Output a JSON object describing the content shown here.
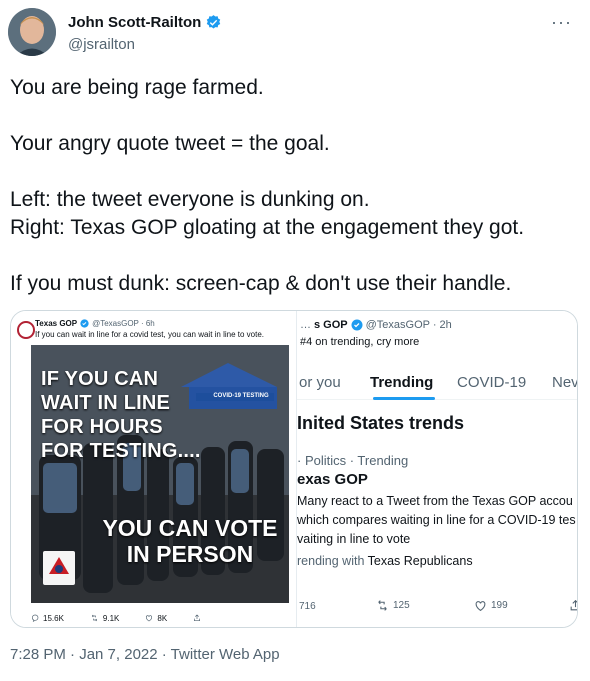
{
  "author": {
    "name": "John Scott-Railton",
    "handle": "@jsrailton"
  },
  "tweet": {
    "lines": [
      "You are being rage farmed.",
      "Your angry quote tweet = the goal.",
      "Left: the tweet everyone is dunking on.\nRight: Texas GOP gloating at the engagement they got.",
      "If you must dunk: screen-cap & don't use their handle."
    ]
  },
  "left_card": {
    "account": "Texas GOP",
    "handle_time": "@TexasGOP · 6h",
    "text": "If you can wait in line for a covid test, you can wait in line to vote.",
    "image_text_top": "IF YOU CAN WAIT IN LINE FOR HOURS FOR TESTING....",
    "image_text_bottom": "YOU CAN VOTE IN PERSON",
    "image_sign": "COVID-19 TESTING",
    "stats": [
      "15.6K",
      "9.1K",
      "8K"
    ]
  },
  "right_card": {
    "prefix": "…",
    "account": "s GOP",
    "handle_time": "@TexasGOP · 2h",
    "text": "#4 on trending, cry more",
    "tabs": [
      "or you",
      "Trending",
      "COVID-19",
      "Nev"
    ],
    "heading": "Inited States trends",
    "context": "· Politics · Trending",
    "trend": "exas GOP",
    "desc": "Many react to a Tweet from the Texas GOP accou\nwhich compares waiting in line for a COVID-19 tes\nvaiting in line to vote",
    "trending_with_label": "rending with ",
    "trending_with_value": "Texas Republicans",
    "stats": [
      "716",
      "125",
      "199"
    ]
  },
  "footer": {
    "timestamp": "7:28 PM · Jan 7, 2022 · Twitter Web App"
  },
  "colors": {
    "verified": "#1d9bf0",
    "text": "#0f1419",
    "muted": "#536471",
    "border": "#cfd9de"
  }
}
